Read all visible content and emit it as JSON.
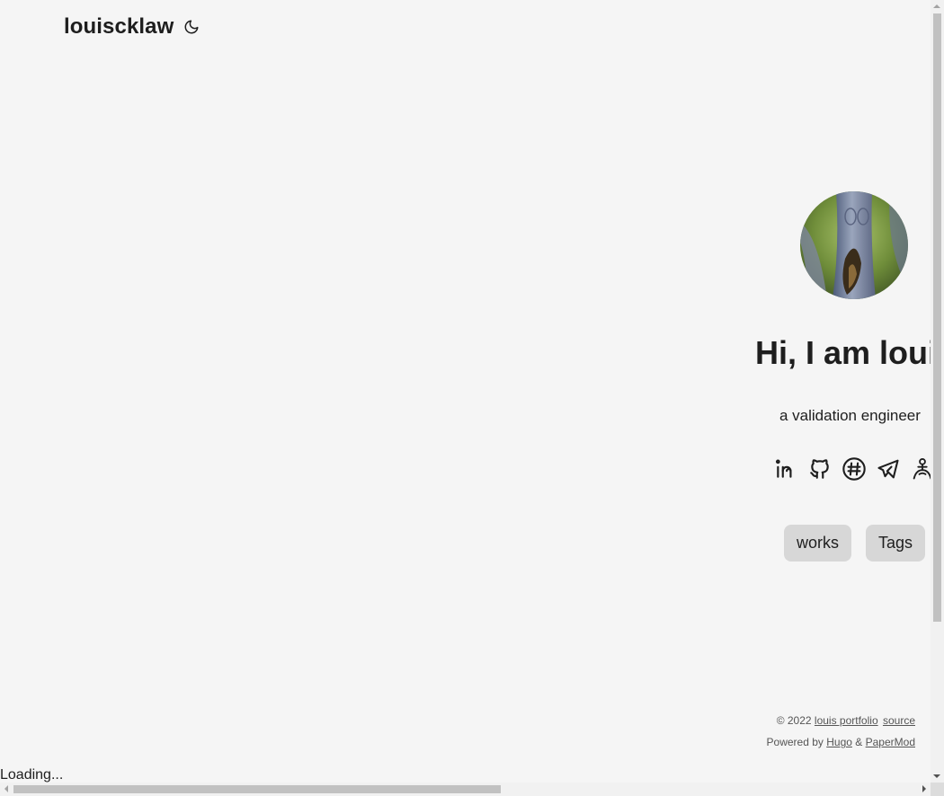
{
  "header": {
    "logo": "louiscklaw",
    "theme_toggle_icon": "moon-icon"
  },
  "profile": {
    "avatar_alt": "profile image",
    "greeting": "Hi, I am loui",
    "subtitle": "a validation engineer",
    "social_icons": [
      "linkedin-icon",
      "github-icon",
      "keybase-icon",
      "telegram-icon",
      "kaggle-icon"
    ],
    "buttons": {
      "works": "works",
      "tags": "Tags"
    }
  },
  "footer": {
    "copyright": "© 2022",
    "site_link": "louis portfolio",
    "source_link": "source",
    "powered_by": "Powered by",
    "hugo_link": "Hugo",
    "amp": "&",
    "papermod_link": "PaperMod"
  },
  "loading_text": "Loading..."
}
